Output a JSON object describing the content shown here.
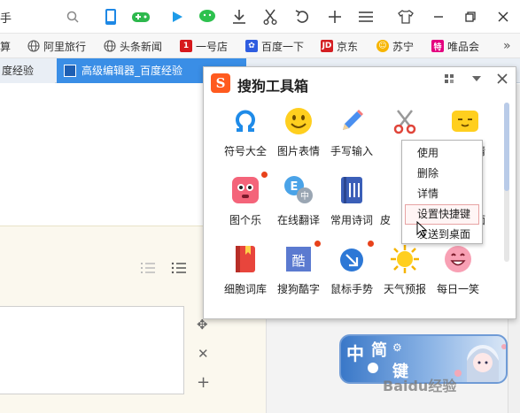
{
  "toolbar": {
    "leading_text": "手"
  },
  "bookmarks": [
    {
      "label": "算",
      "icon": "none"
    },
    {
      "label": "阿里旅行",
      "icon": "globe-icon"
    },
    {
      "label": "头条新闻",
      "icon": "globe-icon"
    },
    {
      "label": "一号店",
      "icon": "yhd-icon"
    },
    {
      "label": "百度一下",
      "icon": "baidu-paw-icon"
    },
    {
      "label": "京东",
      "icon": "jd-icon"
    },
    {
      "label": "苏宁",
      "icon": "suning-icon"
    },
    {
      "label": "唯品会",
      "icon": "vip-icon"
    }
  ],
  "tabs": [
    {
      "label": "度经验"
    },
    {
      "label": "高级编辑器_百度经验"
    }
  ],
  "popup": {
    "logo": "S",
    "title": "搜狗工具箱",
    "tools": [
      {
        "label": "符号大全",
        "icon": "omega-icon",
        "badge": false
      },
      {
        "label": "图片表情",
        "icon": "smiley-icon",
        "badge": false
      },
      {
        "label": "手写输入",
        "icon": "pencil-icon",
        "badge": false
      },
      {
        "label": "",
        "icon": "scissors-icon",
        "badge": false
      },
      {
        "label": "情",
        "icon": "emoticon-box-icon",
        "badge": false
      },
      {
        "label": "图个乐",
        "icon": "pink-face-icon",
        "badge": true
      },
      {
        "label": "在线翻译",
        "icon": "translate-icon",
        "badge": false
      },
      {
        "label": "常用诗词",
        "icon": "book-icon",
        "badge": false
      },
      {
        "label": "皮",
        "icon": "",
        "badge": true
      },
      {
        "label": "面",
        "icon": "",
        "badge": false
      },
      {
        "label": "细胞词库",
        "icon": "red-book-icon",
        "badge": false
      },
      {
        "label": "搜狗酷字",
        "icon": "cool-char-icon",
        "badge": true
      },
      {
        "label": "鼠标手势",
        "icon": "mouse-icon",
        "badge": true
      },
      {
        "label": "天气预报",
        "icon": "sun-icon",
        "badge": false
      },
      {
        "label": "每日一笑",
        "icon": "laugh-icon",
        "badge": false
      }
    ]
  },
  "context_menu": {
    "items": [
      "使用",
      "删除",
      "详情",
      "设置快捷键",
      "发送到桌面"
    ],
    "highlighted_index": 3
  },
  "banner": {
    "chars": [
      "中",
      "简",
      "键"
    ]
  },
  "watermark": "Baidu经验",
  "colors": {
    "accent": "#3a8ee6",
    "sogou_orange": "#ff5a1f",
    "badge_red": "#e8421b"
  }
}
